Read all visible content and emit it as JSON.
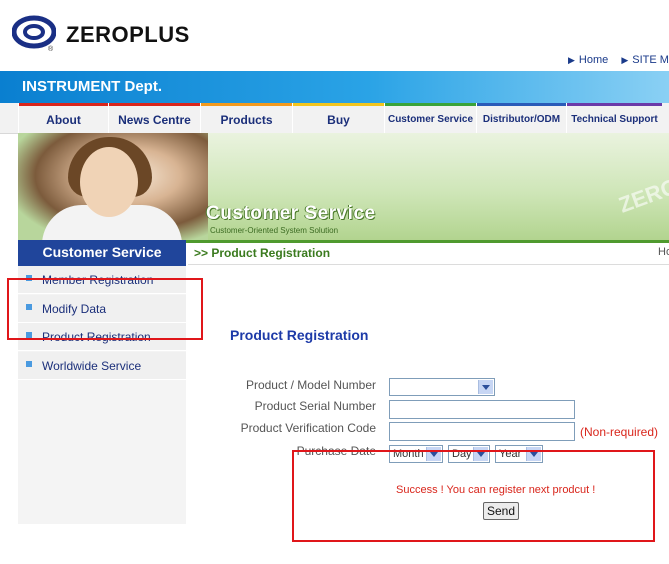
{
  "brand": {
    "logo_text": "ZEROPLUS",
    "reg_mark": "®"
  },
  "top_links": [
    "Home",
    "SITE M"
  ],
  "dept": {
    "title": "INSTRUMENT Dept."
  },
  "nav": [
    {
      "label": "About",
      "stripe": "#d9261c"
    },
    {
      "label": "News Centre",
      "stripe": "#d9261c"
    },
    {
      "label": "Products",
      "stripe": "#f39a1e"
    },
    {
      "label": "Buy",
      "stripe": "#f3c51e"
    },
    {
      "label": "Customer Service",
      "stripe": "#3aa33a"
    },
    {
      "label": "Distributor/ODM",
      "stripe": "#2a5bb8"
    },
    {
      "label": "Technical Support",
      "stripe": "#6b3aa8"
    }
  ],
  "banner": {
    "title": "Customer Service",
    "subtitle": "Customer-Oriented System Solution",
    "watermark": "ZERO"
  },
  "sidebar": {
    "heading": "Customer Service",
    "items": [
      {
        "label": "Member Registration"
      },
      {
        "label": "Modify Data"
      },
      {
        "label": "Product Registration"
      },
      {
        "label": "Worldwide Service"
      }
    ]
  },
  "breadcrumb": {
    "text": ">> Product Registration",
    "right": "Ho"
  },
  "form": {
    "heading": "Product Registration",
    "model_label": "Product / Model Number",
    "model_value": "",
    "serial_label": "Product Serial Number",
    "serial_value": "",
    "verify_label": "Product Verification Code",
    "verify_value": "",
    "verify_note": "(Non-required)",
    "date_label": "Purchase Date",
    "month": "Month",
    "day": "Day",
    "year": "Year",
    "success": "Success ! You can register next prodcut !",
    "send": "Send"
  },
  "colors": {
    "accent_blue": "#20459b",
    "alert_red": "#d9261c",
    "highlight_box": "#e0161a"
  }
}
